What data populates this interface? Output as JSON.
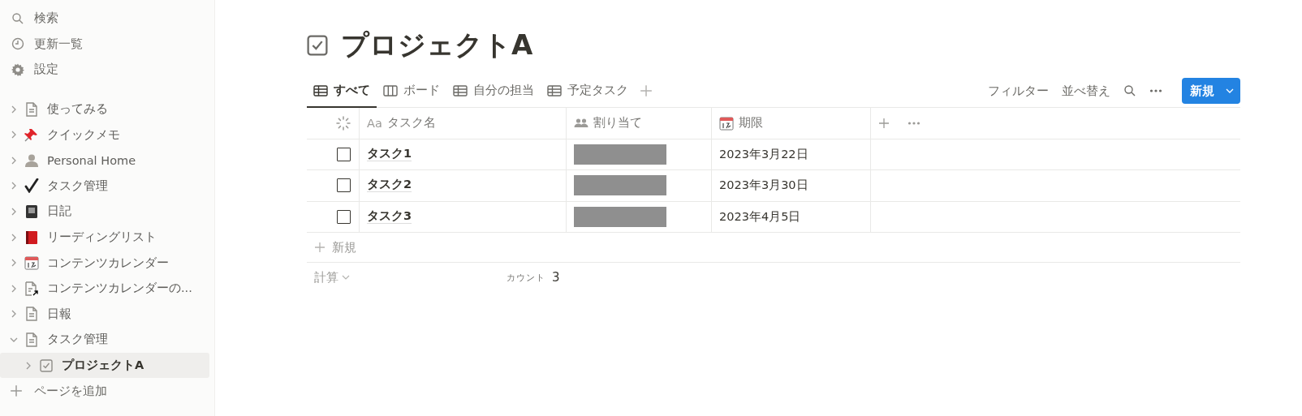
{
  "sidebar": {
    "actions": [
      {
        "kind": "search",
        "label": "検索"
      },
      {
        "kind": "clock",
        "label": "更新一覧"
      },
      {
        "kind": "gear",
        "label": "設定"
      }
    ],
    "pages": [
      {
        "kind": "page",
        "label": "使ってみる",
        "expanded": false,
        "selected": false
      },
      {
        "kind": "pin",
        "label": "クイックメモ",
        "expanded": false,
        "selected": false
      },
      {
        "kind": "person",
        "label": "Personal Home",
        "expanded": false,
        "selected": false
      },
      {
        "kind": "check",
        "label": "タスク管理",
        "expanded": false,
        "selected": false
      },
      {
        "kind": "notebook",
        "label": "日記",
        "expanded": false,
        "selected": false
      },
      {
        "kind": "book",
        "label": "リーディングリスト",
        "expanded": false,
        "selected": false
      },
      {
        "kind": "calendar",
        "label": "コンテンツカレンダー",
        "expanded": false,
        "selected": false
      },
      {
        "kind": "pagelink",
        "label": "コンテンツカレンダーの...",
        "expanded": false,
        "selected": false
      },
      {
        "kind": "page",
        "label": "日報",
        "expanded": false,
        "selected": false
      },
      {
        "kind": "page",
        "label": "タスク管理",
        "expanded": true,
        "selected": false,
        "children": [
          {
            "kind": "checkbox",
            "label": "プロジェクトA",
            "expanded": false,
            "selected": true
          }
        ]
      }
    ],
    "add_page": "ページを追加"
  },
  "page": {
    "title": "プロジェクトA",
    "tabs": [
      {
        "kind": "table",
        "label": "すべて",
        "selected": true
      },
      {
        "kind": "board",
        "label": "ボード",
        "selected": false
      },
      {
        "kind": "table",
        "label": "自分の担当",
        "selected": false
      },
      {
        "kind": "table",
        "label": "予定タスク",
        "selected": false
      }
    ],
    "toolbar": {
      "filter": "フィルター",
      "sort": "並べ替え",
      "new_button": "新規"
    },
    "table": {
      "columns": [
        {
          "kind": "status"
        },
        {
          "kind": "text",
          "prefix": "Aa",
          "label": "タスク名"
        },
        {
          "kind": "people",
          "label": "割り当て"
        },
        {
          "kind": "calendar",
          "label": "期限"
        }
      ],
      "rows": [
        {
          "checked": false,
          "name": "タスク1",
          "assignee": {
            "kind": "redacted"
          },
          "due": "2023年3月22日"
        },
        {
          "checked": false,
          "name": "タスク2",
          "assignee": {
            "kind": "redacted"
          },
          "due": "2023年3月30日"
        },
        {
          "checked": false,
          "name": "タスク3",
          "assignee": {
            "kind": "redacted"
          },
          "due": "2023年4月5日"
        }
      ],
      "new_row": "新規",
      "footer": {
        "calc": "計算",
        "count_label": "カウント",
        "count": "3"
      }
    }
  }
}
